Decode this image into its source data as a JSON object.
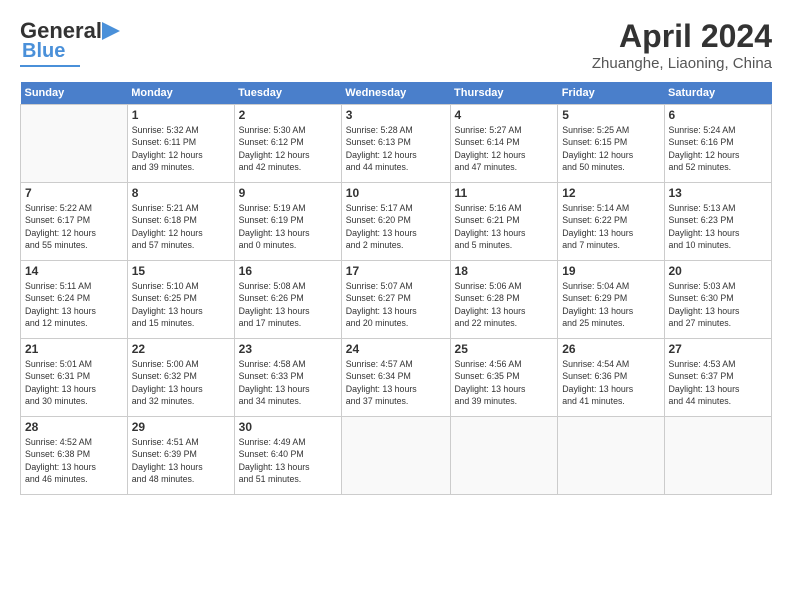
{
  "header": {
    "logo_line1": "General",
    "logo_line2": "Blue",
    "month": "April 2024",
    "location": "Zhuanghe, Liaoning, China"
  },
  "days_of_week": [
    "Sunday",
    "Monday",
    "Tuesday",
    "Wednesday",
    "Thursday",
    "Friday",
    "Saturday"
  ],
  "weeks": [
    [
      {
        "day": "",
        "info": ""
      },
      {
        "day": "1",
        "info": "Sunrise: 5:32 AM\nSunset: 6:11 PM\nDaylight: 12 hours\nand 39 minutes."
      },
      {
        "day": "2",
        "info": "Sunrise: 5:30 AM\nSunset: 6:12 PM\nDaylight: 12 hours\nand 42 minutes."
      },
      {
        "day": "3",
        "info": "Sunrise: 5:28 AM\nSunset: 6:13 PM\nDaylight: 12 hours\nand 44 minutes."
      },
      {
        "day": "4",
        "info": "Sunrise: 5:27 AM\nSunset: 6:14 PM\nDaylight: 12 hours\nand 47 minutes."
      },
      {
        "day": "5",
        "info": "Sunrise: 5:25 AM\nSunset: 6:15 PM\nDaylight: 12 hours\nand 50 minutes."
      },
      {
        "day": "6",
        "info": "Sunrise: 5:24 AM\nSunset: 6:16 PM\nDaylight: 12 hours\nand 52 minutes."
      }
    ],
    [
      {
        "day": "7",
        "info": "Sunrise: 5:22 AM\nSunset: 6:17 PM\nDaylight: 12 hours\nand 55 minutes."
      },
      {
        "day": "8",
        "info": "Sunrise: 5:21 AM\nSunset: 6:18 PM\nDaylight: 12 hours\nand 57 minutes."
      },
      {
        "day": "9",
        "info": "Sunrise: 5:19 AM\nSunset: 6:19 PM\nDaylight: 13 hours\nand 0 minutes."
      },
      {
        "day": "10",
        "info": "Sunrise: 5:17 AM\nSunset: 6:20 PM\nDaylight: 13 hours\nand 2 minutes."
      },
      {
        "day": "11",
        "info": "Sunrise: 5:16 AM\nSunset: 6:21 PM\nDaylight: 13 hours\nand 5 minutes."
      },
      {
        "day": "12",
        "info": "Sunrise: 5:14 AM\nSunset: 6:22 PM\nDaylight: 13 hours\nand 7 minutes."
      },
      {
        "day": "13",
        "info": "Sunrise: 5:13 AM\nSunset: 6:23 PM\nDaylight: 13 hours\nand 10 minutes."
      }
    ],
    [
      {
        "day": "14",
        "info": "Sunrise: 5:11 AM\nSunset: 6:24 PM\nDaylight: 13 hours\nand 12 minutes."
      },
      {
        "day": "15",
        "info": "Sunrise: 5:10 AM\nSunset: 6:25 PM\nDaylight: 13 hours\nand 15 minutes."
      },
      {
        "day": "16",
        "info": "Sunrise: 5:08 AM\nSunset: 6:26 PM\nDaylight: 13 hours\nand 17 minutes."
      },
      {
        "day": "17",
        "info": "Sunrise: 5:07 AM\nSunset: 6:27 PM\nDaylight: 13 hours\nand 20 minutes."
      },
      {
        "day": "18",
        "info": "Sunrise: 5:06 AM\nSunset: 6:28 PM\nDaylight: 13 hours\nand 22 minutes."
      },
      {
        "day": "19",
        "info": "Sunrise: 5:04 AM\nSunset: 6:29 PM\nDaylight: 13 hours\nand 25 minutes."
      },
      {
        "day": "20",
        "info": "Sunrise: 5:03 AM\nSunset: 6:30 PM\nDaylight: 13 hours\nand 27 minutes."
      }
    ],
    [
      {
        "day": "21",
        "info": "Sunrise: 5:01 AM\nSunset: 6:31 PM\nDaylight: 13 hours\nand 30 minutes."
      },
      {
        "day": "22",
        "info": "Sunrise: 5:00 AM\nSunset: 6:32 PM\nDaylight: 13 hours\nand 32 minutes."
      },
      {
        "day": "23",
        "info": "Sunrise: 4:58 AM\nSunset: 6:33 PM\nDaylight: 13 hours\nand 34 minutes."
      },
      {
        "day": "24",
        "info": "Sunrise: 4:57 AM\nSunset: 6:34 PM\nDaylight: 13 hours\nand 37 minutes."
      },
      {
        "day": "25",
        "info": "Sunrise: 4:56 AM\nSunset: 6:35 PM\nDaylight: 13 hours\nand 39 minutes."
      },
      {
        "day": "26",
        "info": "Sunrise: 4:54 AM\nSunset: 6:36 PM\nDaylight: 13 hours\nand 41 minutes."
      },
      {
        "day": "27",
        "info": "Sunrise: 4:53 AM\nSunset: 6:37 PM\nDaylight: 13 hours\nand 44 minutes."
      }
    ],
    [
      {
        "day": "28",
        "info": "Sunrise: 4:52 AM\nSunset: 6:38 PM\nDaylight: 13 hours\nand 46 minutes."
      },
      {
        "day": "29",
        "info": "Sunrise: 4:51 AM\nSunset: 6:39 PM\nDaylight: 13 hours\nand 48 minutes."
      },
      {
        "day": "30",
        "info": "Sunrise: 4:49 AM\nSunset: 6:40 PM\nDaylight: 13 hours\nand 51 minutes."
      },
      {
        "day": "",
        "info": ""
      },
      {
        "day": "",
        "info": ""
      },
      {
        "day": "",
        "info": ""
      },
      {
        "day": "",
        "info": ""
      }
    ]
  ]
}
